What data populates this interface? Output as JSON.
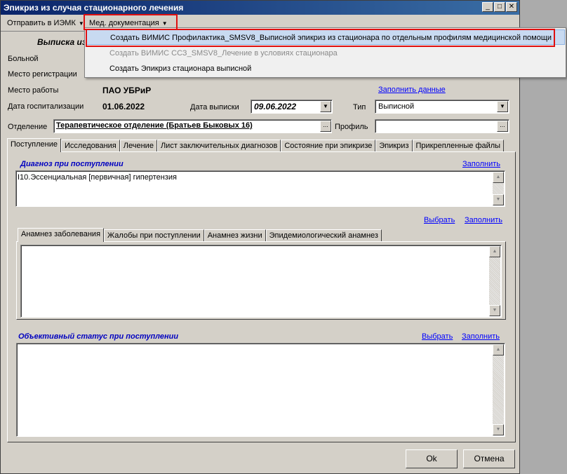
{
  "window": {
    "title": "Эпикриз из случая стационарного лечения"
  },
  "toolbar": {
    "send_iemk": "Отправить в ИЭМК",
    "med_docs": "Мед. документация"
  },
  "menu": {
    "items": [
      {
        "label": "Создать ВИМИС Профилактика_SMSV8_Выписной эпикриз из стационара по отдельным профилям медицинской помощи",
        "state": "highlighted"
      },
      {
        "label": "Создать ВИМИС ССЗ_SMSV8_Лечение в условиях стационара",
        "state": "disabled"
      },
      {
        "label": "Создать Эпикриз стационара выписной",
        "state": "normal"
      }
    ]
  },
  "header": {
    "vypiska_partial": "Выписка из"
  },
  "fields": {
    "patient_label": "Больной",
    "registration_label": "Место регистрации",
    "work_label": "Место работы",
    "work_value": "ПАО УБРиР",
    "fill_data_link": "Заполнить данные",
    "hosp_date_label": "Дата госпитализации",
    "hosp_date_value": "01.06.2022",
    "discharge_date_label": "Дата выписки",
    "discharge_date_value": "09.06.2022",
    "type_label": "Тип",
    "type_value": "Выписной",
    "department_label": "Отделение",
    "department_value": "Терапевтическое отделение (Братьев Быковых 16)",
    "profile_label": "Профиль",
    "profile_value": "",
    "ellipsis": "..."
  },
  "tabs": [
    {
      "label": "Поступление",
      "active": true
    },
    {
      "label": "Исследования",
      "active": false
    },
    {
      "label": "Лечение",
      "active": false
    },
    {
      "label": "Лист заключительных диагнозов",
      "active": false
    },
    {
      "label": "Состояние при эпикризе",
      "active": false
    },
    {
      "label": "Эпикриз",
      "active": false
    },
    {
      "label": "Прикрепленные файлы",
      "active": false
    }
  ],
  "admission": {
    "diagnosis_title": "Диагноз при поступлении",
    "fill": "Заполнить",
    "choose": "Выбрать",
    "diagnosis_text": "I10.Эссенциальная [первичная] гипертензия",
    "anamnesis_tabs": [
      {
        "label": "Анамнез заболевания",
        "active": true
      },
      {
        "label": "Жалобы при поступлении",
        "active": false
      },
      {
        "label": "Анамнез жизни",
        "active": false
      },
      {
        "label": "Эпидемиологический анамнез",
        "active": false
      }
    ],
    "objective_title": "Объективный статус при поступлении"
  },
  "buttons": {
    "ok": "Ok",
    "cancel": "Отмена"
  },
  "colors": {
    "highlight_border": "#e01010",
    "link": "#0000ff",
    "section_title": "#0000c0"
  }
}
